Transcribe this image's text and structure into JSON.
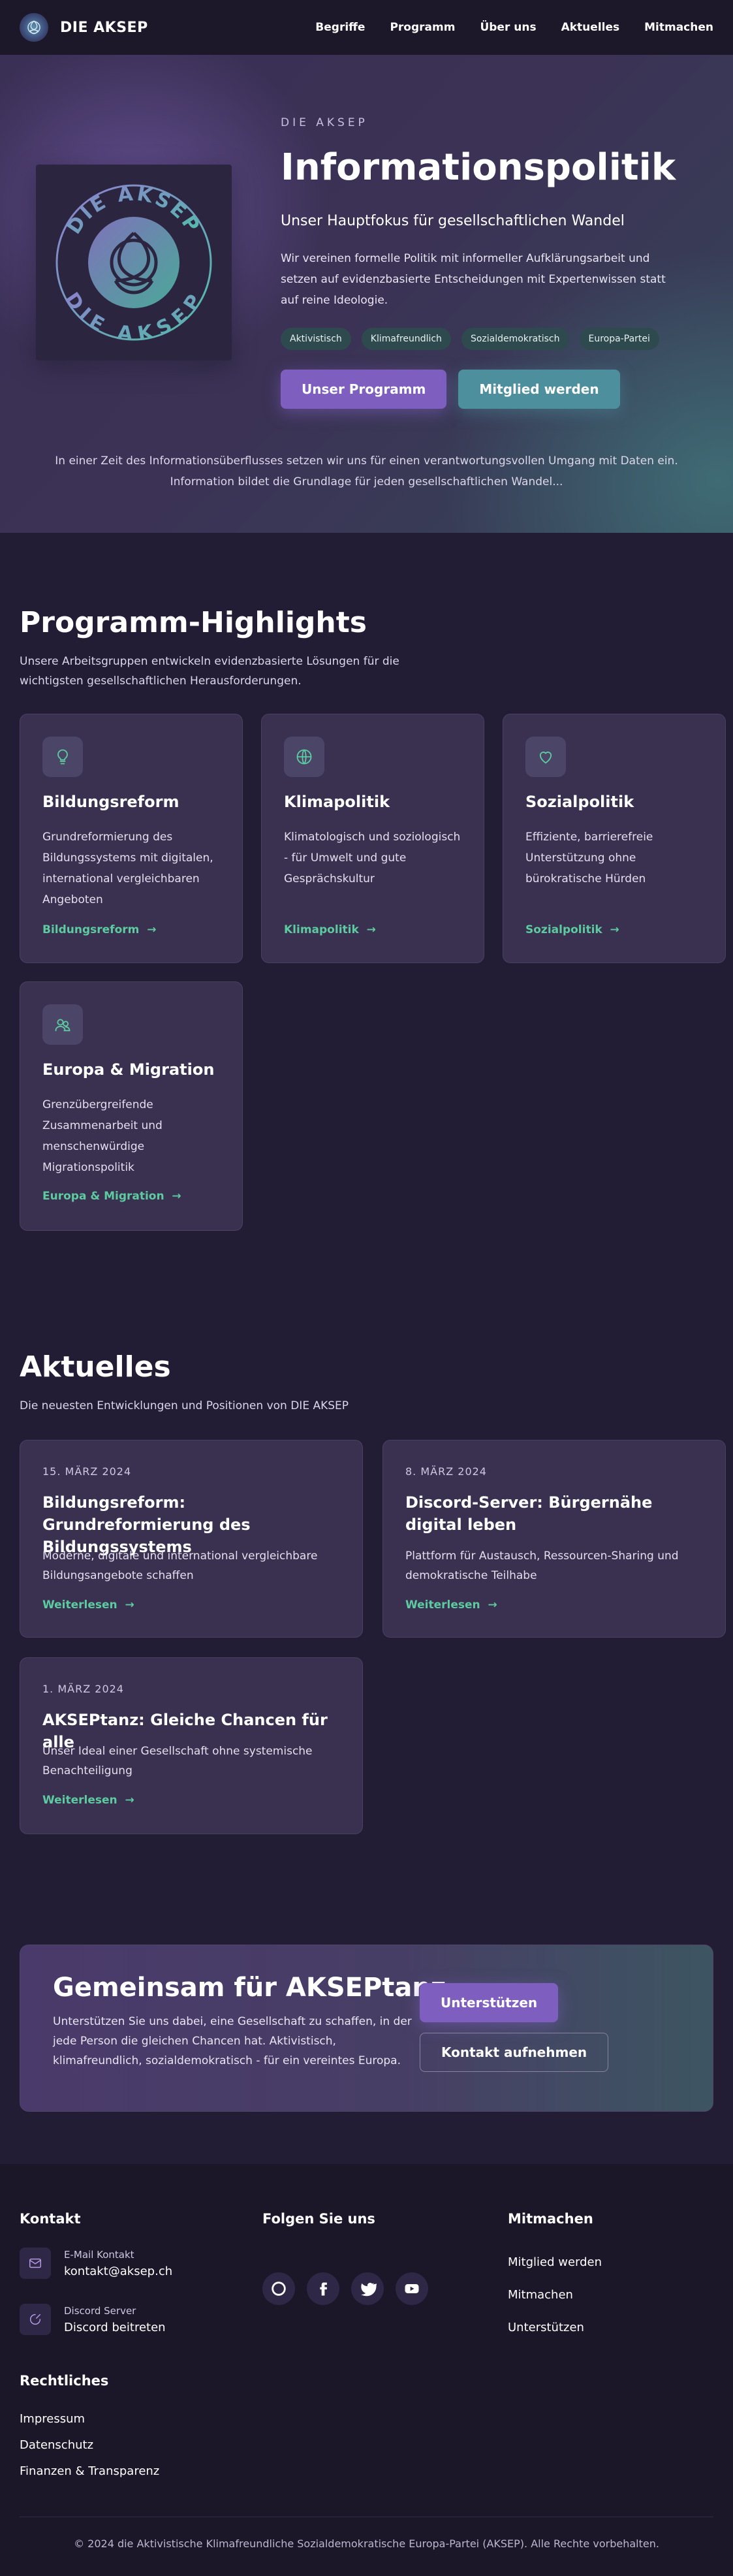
{
  "nav": {
    "brand": "DIE AKSEP",
    "links": [
      "Begriffe",
      "Programm",
      "Über uns",
      "Aktuelles",
      "Mitmachen"
    ]
  },
  "hero": {
    "emblem_text": "DIE AKSEP",
    "kicker": "DIE AKSEP",
    "title": "Informationspolitik",
    "subtitle": "Unser Hauptfokus für gesellschaftlichen Wandel",
    "description": "Wir vereinen formelle Politik mit informeller Aufklärungsarbeit und setzen auf evidenzbasierte Entscheidungen mit Expertenwissen statt auf reine Ideologie.",
    "tags": [
      "Aktivistisch",
      "Klimafreundlich",
      "Sozialdemokratisch",
      "Europa-Partei"
    ],
    "primary_button": "Unser Programm",
    "secondary_button": "Mitglied werden",
    "intro_line1": "In einer Zeit des Informationsüberflusses setzen wir uns für einen verantwortungsvollen Umgang mit Daten ein.",
    "intro_line2": "Information bildet die Grundlage für jeden gesellschaftlichen Wandel..."
  },
  "program": {
    "title": "Programm-Highlights",
    "subtitle_line1": "Unsere Arbeitsgruppen entwickeln evidenzbasierte Lösungen für die",
    "subtitle_line2": "wichtigsten gesellschaftlichen Herausforderungen.",
    "cards": [
      {
        "icon": "lightbulb-icon",
        "title": "Bildungsreform",
        "text": "Grundreformierung des Bildungssystems mit digitalen, international vergleichbaren Angeboten",
        "link": "Bildungsreform"
      },
      {
        "icon": "globe-icon",
        "title": "Klimapolitik",
        "text": "Klimatologisch und soziologisch - für Umwelt und gute Gesprächskultur",
        "link": "Klimapolitik"
      },
      {
        "icon": "heart-icon",
        "title": "Sozialpolitik",
        "text": "Effiziente, barrierefreie Unterstützung ohne bürokratische Hürden",
        "link": "Sozialpolitik"
      },
      {
        "icon": "people-icon",
        "title": "Europa & Migration",
        "text": "Grenzübergreifende Zusammenarbeit und menschenwürdige Migrationspolitik",
        "link": "Europa & Migration"
      }
    ]
  },
  "news": {
    "title": "Aktuelles",
    "subtitle": "Die neuesten Entwicklungen und Positionen von DIE AKSEP",
    "read_more": "Weiterlesen",
    "items": [
      {
        "date": "15. MÄRZ 2024",
        "title": "Bildungsreform: Grundreformierung des Bildungssystems",
        "text": "Moderne, digitale und international vergleichbare Bildungsangebote schaffen"
      },
      {
        "date": "8. MÄRZ 2024",
        "title": "Discord-Server: Bürgernähe digital leben",
        "text": "Plattform für Austausch, Ressourcen-Sharing und demokratische Teilhabe"
      },
      {
        "date": "1. MÄRZ 2024",
        "title": "AKSEPtanz: Gleiche Chancen für alle",
        "text": "Unser Ideal einer Gesellschaft ohne systemische Benachteiligung"
      }
    ]
  },
  "cta": {
    "title": "Gemeinsam für AKSEPtanz",
    "text": "Unterstützen Sie uns dabei, eine Gesellschaft zu schaffen, in der jede Person die gleichen Chancen hat. Aktivistisch, klimafreundlich, sozialdemokratisch - für ein vereintes Europa.",
    "primary_button": "Unterstützen",
    "secondary_button": "Kontakt aufnehmen"
  },
  "footer": {
    "contact_title": "Kontakt",
    "email_label": "E-Mail Kontakt",
    "email_value": "kontakt@aksep.ch",
    "discord_label": "Discord Server",
    "discord_value": "Discord beitreten",
    "social_title": "Folgen Sie uns",
    "social_icons": [
      "github-icon",
      "facebook-icon",
      "twitter-icon",
      "youtube-icon"
    ],
    "join_title": "Mitmachen",
    "join_links": [
      "Mitglied werden",
      "Mitmachen",
      "Unterstützen"
    ],
    "legal_title": "Rechtliches",
    "legal_links": [
      "Impressum",
      "Datenschutz",
      "Finanzen & Transparenz"
    ],
    "copyright": "© 2024 die Aktivistische Klimafreundliche Sozialdemokratische Europa-Partei (AKSEP). Alle Rechte vorbehalten."
  },
  "colors": {
    "accent_purple": "#7e5fbf",
    "accent_teal": "#4e8f9e",
    "link_green": "#5dcba0",
    "background": "#221c35"
  }
}
